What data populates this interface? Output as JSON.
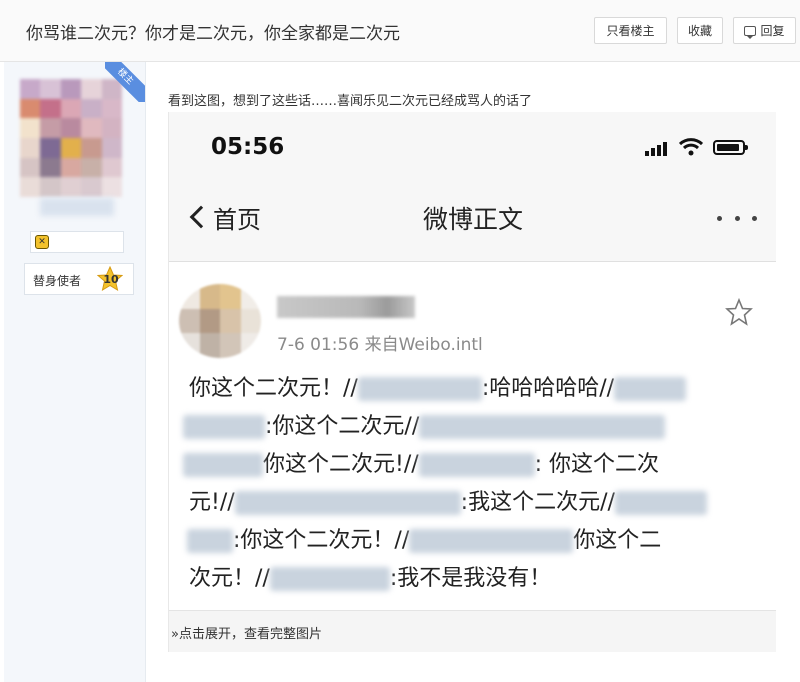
{
  "header": {
    "title": "你骂谁二次元？你才是二次元，你全家都是二次元",
    "only_op_label": "只看楼主",
    "favorite_label": "收藏",
    "reply_label": "回复"
  },
  "user": {
    "op_badge": "楼主",
    "level_name": "替身使者",
    "level_num": "10"
  },
  "post": {
    "text": "看到这图，想到了这些话……喜闻乐见二次元已经成骂人的话了",
    "expand_label": "点击展开，查看完整图片"
  },
  "screenshot": {
    "status_time": "05:56",
    "nav_back_label": "首页",
    "nav_title": "微博正文",
    "meta": "7-6 01:56  来自Weibo.intl",
    "lines": {
      "l1a": "你这个二次元！//",
      "l1b": ":哈哈哈哈哈//",
      "l2a": ":你这个二次元//",
      "l3a": "你这个二次元!//",
      "l3b": ": 你这个二次",
      "l4a": "元!//",
      "l4b": ":我这个二次元//",
      "l5a": ":你这个二次元！//",
      "l5b": "你这个二",
      "l6a": "次元！//",
      "l6b": ":我不是我没有！"
    }
  },
  "colors": {
    "accent_blue": "#5a8ee0",
    "level_gold": "#f3c22c",
    "sidebar_bg": "#f4f7fb"
  }
}
